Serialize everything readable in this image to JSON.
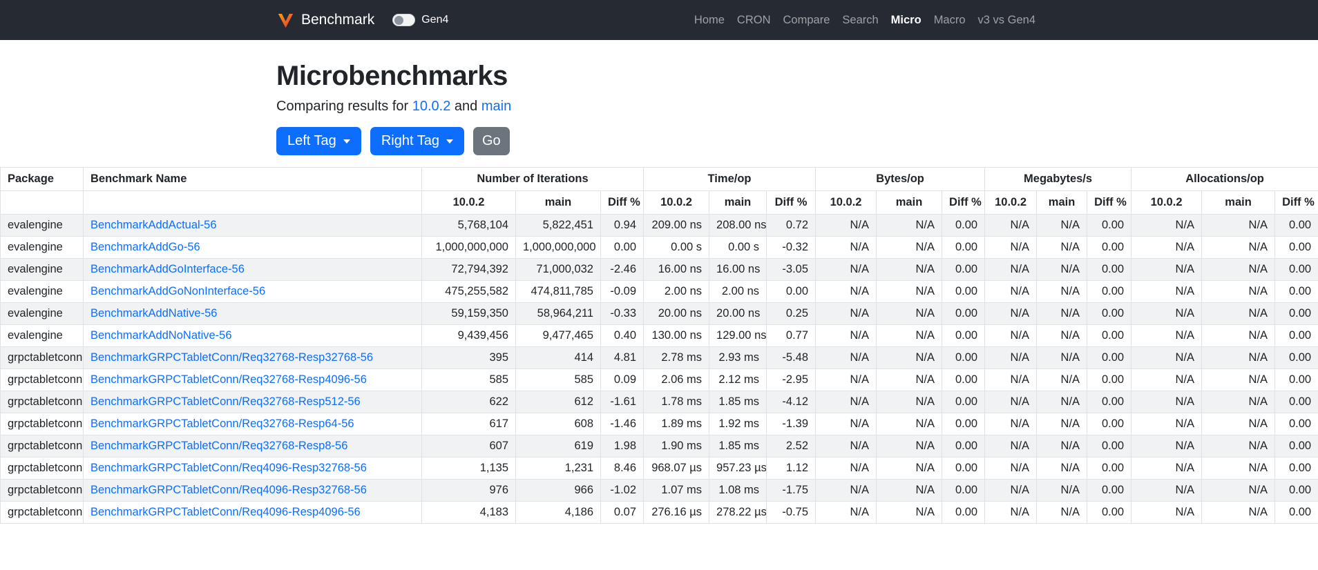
{
  "colors": {
    "accent": "#0d6efd",
    "navbar_bg": "#262b33",
    "secondary_button": "#6c757d",
    "brand_orange": "#f26722"
  },
  "navbar": {
    "brand": "Benchmark",
    "gen4_toggle": {
      "label": "Gen4",
      "state": "off"
    },
    "items": [
      {
        "label": "Home",
        "active": false
      },
      {
        "label": "CRON",
        "active": false
      },
      {
        "label": "Compare",
        "active": false
      },
      {
        "label": "Search",
        "active": false
      },
      {
        "label": "Micro",
        "active": true
      },
      {
        "label": "Macro",
        "active": false
      },
      {
        "label": "v3 vs Gen4",
        "active": false
      }
    ]
  },
  "page": {
    "title": "Microbenchmarks",
    "subtitle_prefix": "Comparing results for",
    "left_tag_link": "10.0.2",
    "subtitle_middle": "and",
    "right_tag_link": "main"
  },
  "controls": {
    "left_tag_label": "Left Tag",
    "right_tag_label": "Right Tag",
    "go_label": "Go"
  },
  "table": {
    "package_header": "Package",
    "name_header": "Benchmark Name",
    "col_groups": [
      "Number of Iterations",
      "Time/op",
      "Bytes/op",
      "Megabytes/s",
      "Allocations/op"
    ],
    "sub_cols": [
      "10.0.2",
      "main",
      "Diff %"
    ],
    "rows": [
      {
        "package": "evalengine",
        "name": "BenchmarkAddActual-56",
        "iterations": [
          "5,768,104",
          "5,822,451",
          "0.94"
        ],
        "time": [
          "209.00 ns",
          "208.00 ns",
          "0.72"
        ],
        "bytes": [
          "N/A",
          "N/A",
          "0.00"
        ],
        "megabytes": [
          "N/A",
          "N/A",
          "0.00"
        ],
        "allocations": [
          "N/A",
          "N/A",
          "0.00"
        ]
      },
      {
        "package": "evalengine",
        "name": "BenchmarkAddGo-56",
        "iterations": [
          "1,000,000,000",
          "1,000,000,000",
          "0.00"
        ],
        "time": [
          "0.00 s",
          "0.00 s",
          "-0.32"
        ],
        "bytes": [
          "N/A",
          "N/A",
          "0.00"
        ],
        "megabytes": [
          "N/A",
          "N/A",
          "0.00"
        ],
        "allocations": [
          "N/A",
          "N/A",
          "0.00"
        ]
      },
      {
        "package": "evalengine",
        "name": "BenchmarkAddGoInterface-56",
        "iterations": [
          "72,794,392",
          "71,000,032",
          "-2.46"
        ],
        "time": [
          "16.00 ns",
          "16.00 ns",
          "-3.05"
        ],
        "bytes": [
          "N/A",
          "N/A",
          "0.00"
        ],
        "megabytes": [
          "N/A",
          "N/A",
          "0.00"
        ],
        "allocations": [
          "N/A",
          "N/A",
          "0.00"
        ]
      },
      {
        "package": "evalengine",
        "name": "BenchmarkAddGoNonInterface-56",
        "iterations": [
          "475,255,582",
          "474,811,785",
          "-0.09"
        ],
        "time": [
          "2.00 ns",
          "2.00 ns",
          "0.00"
        ],
        "bytes": [
          "N/A",
          "N/A",
          "0.00"
        ],
        "megabytes": [
          "N/A",
          "N/A",
          "0.00"
        ],
        "allocations": [
          "N/A",
          "N/A",
          "0.00"
        ]
      },
      {
        "package": "evalengine",
        "name": "BenchmarkAddNative-56",
        "iterations": [
          "59,159,350",
          "58,964,211",
          "-0.33"
        ],
        "time": [
          "20.00 ns",
          "20.00 ns",
          "0.25"
        ],
        "bytes": [
          "N/A",
          "N/A",
          "0.00"
        ],
        "megabytes": [
          "N/A",
          "N/A",
          "0.00"
        ],
        "allocations": [
          "N/A",
          "N/A",
          "0.00"
        ]
      },
      {
        "package": "evalengine",
        "name": "BenchmarkAddNoNative-56",
        "iterations": [
          "9,439,456",
          "9,477,465",
          "0.40"
        ],
        "time": [
          "130.00 ns",
          "129.00 ns",
          "0.77"
        ],
        "bytes": [
          "N/A",
          "N/A",
          "0.00"
        ],
        "megabytes": [
          "N/A",
          "N/A",
          "0.00"
        ],
        "allocations": [
          "N/A",
          "N/A",
          "0.00"
        ]
      },
      {
        "package": "grpctabletconn",
        "name": "BenchmarkGRPCTabletConn/Req32768-Resp32768-56",
        "iterations": [
          "395",
          "414",
          "4.81"
        ],
        "time": [
          "2.78 ms",
          "2.93 ms",
          "-5.48"
        ],
        "bytes": [
          "N/A",
          "N/A",
          "0.00"
        ],
        "megabytes": [
          "N/A",
          "N/A",
          "0.00"
        ],
        "allocations": [
          "N/A",
          "N/A",
          "0.00"
        ]
      },
      {
        "package": "grpctabletconn",
        "name": "BenchmarkGRPCTabletConn/Req32768-Resp4096-56",
        "iterations": [
          "585",
          "585",
          "0.09"
        ],
        "time": [
          "2.06 ms",
          "2.12 ms",
          "-2.95"
        ],
        "bytes": [
          "N/A",
          "N/A",
          "0.00"
        ],
        "megabytes": [
          "N/A",
          "N/A",
          "0.00"
        ],
        "allocations": [
          "N/A",
          "N/A",
          "0.00"
        ]
      },
      {
        "package": "grpctabletconn",
        "name": "BenchmarkGRPCTabletConn/Req32768-Resp512-56",
        "iterations": [
          "622",
          "612",
          "-1.61"
        ],
        "time": [
          "1.78 ms",
          "1.85 ms",
          "-4.12"
        ],
        "bytes": [
          "N/A",
          "N/A",
          "0.00"
        ],
        "megabytes": [
          "N/A",
          "N/A",
          "0.00"
        ],
        "allocations": [
          "N/A",
          "N/A",
          "0.00"
        ]
      },
      {
        "package": "grpctabletconn",
        "name": "BenchmarkGRPCTabletConn/Req32768-Resp64-56",
        "iterations": [
          "617",
          "608",
          "-1.46"
        ],
        "time": [
          "1.89 ms",
          "1.92 ms",
          "-1.39"
        ],
        "bytes": [
          "N/A",
          "N/A",
          "0.00"
        ],
        "megabytes": [
          "N/A",
          "N/A",
          "0.00"
        ],
        "allocations": [
          "N/A",
          "N/A",
          "0.00"
        ]
      },
      {
        "package": "grpctabletconn",
        "name": "BenchmarkGRPCTabletConn/Req32768-Resp8-56",
        "iterations": [
          "607",
          "619",
          "1.98"
        ],
        "time": [
          "1.90 ms",
          "1.85 ms",
          "2.52"
        ],
        "bytes": [
          "N/A",
          "N/A",
          "0.00"
        ],
        "megabytes": [
          "N/A",
          "N/A",
          "0.00"
        ],
        "allocations": [
          "N/A",
          "N/A",
          "0.00"
        ]
      },
      {
        "package": "grpctabletconn",
        "name": "BenchmarkGRPCTabletConn/Req4096-Resp32768-56",
        "iterations": [
          "1,135",
          "1,231",
          "8.46"
        ],
        "time": [
          "968.07 µs",
          "957.23 µs",
          "1.12"
        ],
        "bytes": [
          "N/A",
          "N/A",
          "0.00"
        ],
        "megabytes": [
          "N/A",
          "N/A",
          "0.00"
        ],
        "allocations": [
          "N/A",
          "N/A",
          "0.00"
        ]
      },
      {
        "package": "grpctabletconn",
        "name": "BenchmarkGRPCTabletConn/Req4096-Resp32768-56",
        "iterations": [
          "976",
          "966",
          "-1.02"
        ],
        "time": [
          "1.07 ms",
          "1.08 ms",
          "-1.75"
        ],
        "bytes": [
          "N/A",
          "N/A",
          "0.00"
        ],
        "megabytes": [
          "N/A",
          "N/A",
          "0.00"
        ],
        "allocations": [
          "N/A",
          "N/A",
          "0.00"
        ]
      },
      {
        "package": "grpctabletconn",
        "name": "BenchmarkGRPCTabletConn/Req4096-Resp4096-56",
        "iterations": [
          "4,183",
          "4,186",
          "0.07"
        ],
        "time": [
          "276.16 µs",
          "278.22 µs",
          "-0.75"
        ],
        "bytes": [
          "N/A",
          "N/A",
          "0.00"
        ],
        "megabytes": [
          "N/A",
          "N/A",
          "0.00"
        ],
        "allocations": [
          "N/A",
          "N/A",
          "0.00"
        ]
      }
    ]
  }
}
